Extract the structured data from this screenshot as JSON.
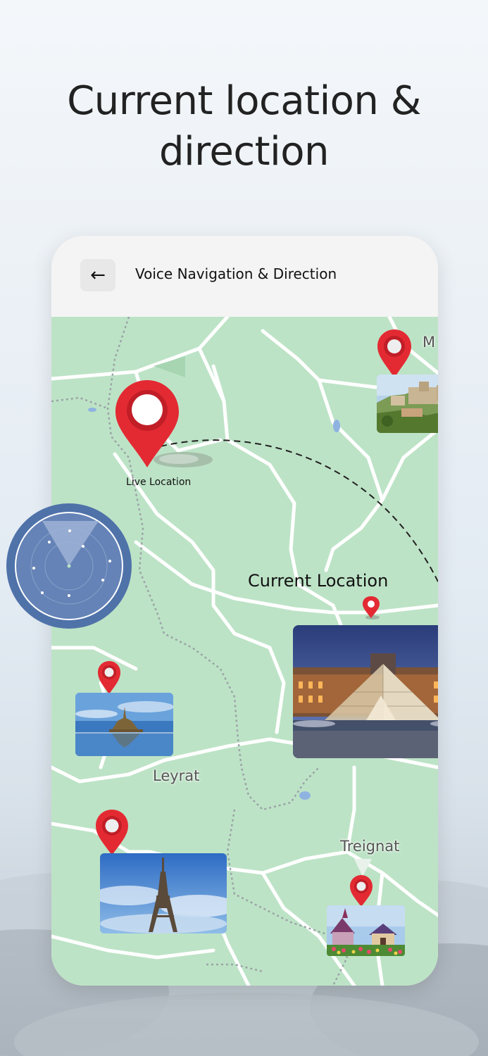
{
  "headline": {
    "line1": "Current location &",
    "line2": "direction"
  },
  "app_bar": {
    "back_icon": "arrow-left-icon",
    "back_glyph": "←",
    "title": "Voice Navigation & Direction"
  },
  "map": {
    "live_location_label": "Live Location",
    "current_location_label": "Current Location",
    "town_labels": {
      "leyrat": "Leyrat",
      "treignat": "Treignat",
      "m_partial": "M"
    }
  },
  "colors": {
    "map_green": "#bde3c6",
    "pin_red": "#e32a33",
    "radar_blue": "#4f72a9"
  }
}
